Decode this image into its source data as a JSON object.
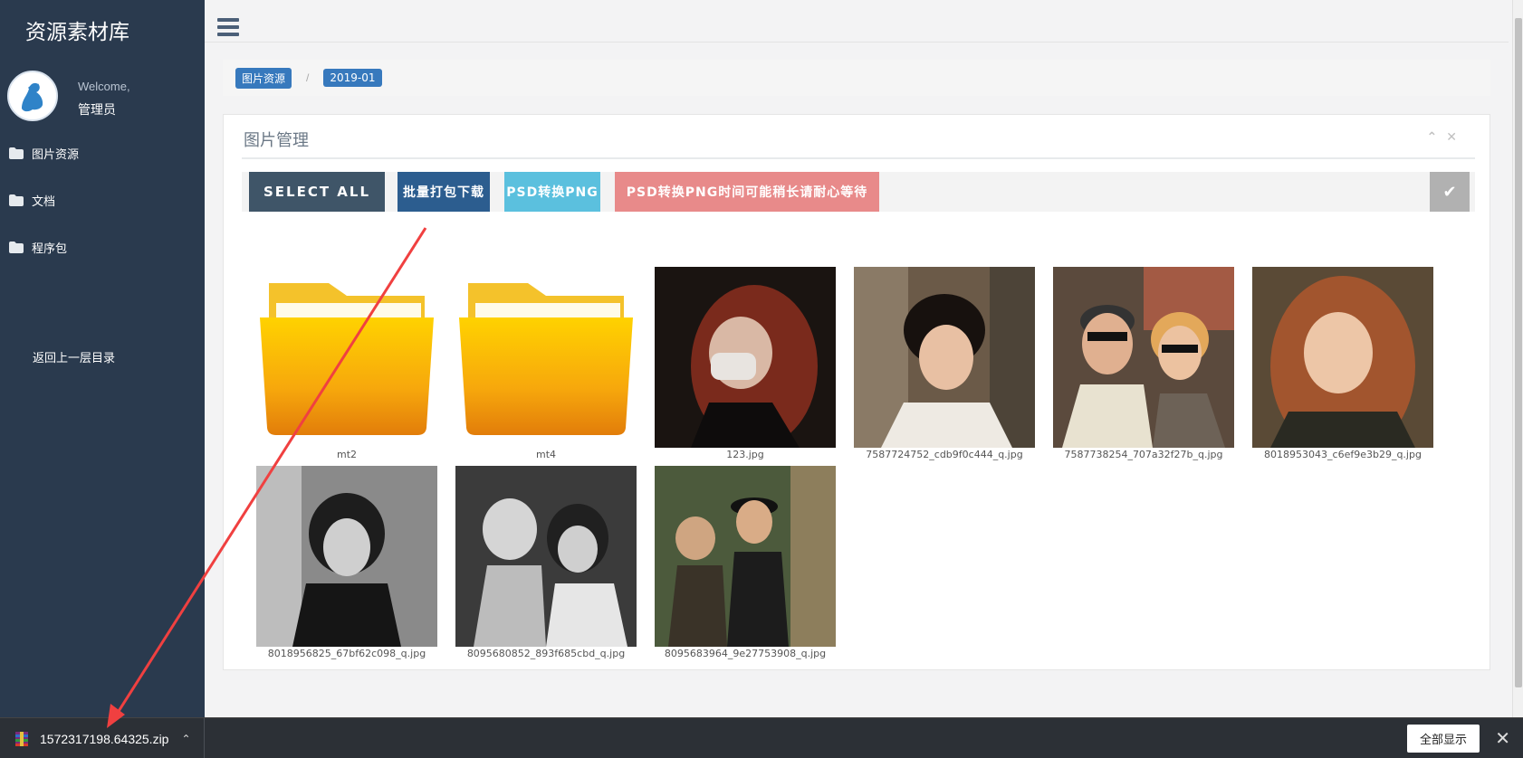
{
  "sidebar": {
    "brand": "资源素材库",
    "welcome": "Welcome,",
    "username": "管理员",
    "items": [
      {
        "label": "图片资源",
        "icon": "folder-icon"
      },
      {
        "label": "文档",
        "icon": "folder-icon"
      },
      {
        "label": "程序包",
        "icon": "folder-icon"
      }
    ],
    "back_label": "返回上一层目录"
  },
  "breadcrumb": [
    "图片资源",
    "2019-01"
  ],
  "breadcrumb_sep": "/",
  "panel": {
    "title": "图片管理",
    "tools": {
      "collapse": "⌃",
      "close": "✕"
    }
  },
  "toolbar": {
    "select_all": "SELECT ALL",
    "batch_download": "批量打包下载",
    "psd_to_png": "PSD转换PNG",
    "psd_warning": "PSD转换PNG时间可能稍长请耐心等待",
    "confirm_icon": "✔"
  },
  "files": [
    {
      "name": "mt2",
      "type": "folder"
    },
    {
      "name": "mt4",
      "type": "folder"
    },
    {
      "name": "123.jpg",
      "type": "image"
    },
    {
      "name": "7587724752_cdb9f0c444_q.jpg",
      "type": "image"
    },
    {
      "name": "7587738254_707a32f27b_q.jpg",
      "type": "image"
    },
    {
      "name": "8018953043_c6ef9e3b29_q.jpg",
      "type": "image"
    },
    {
      "name": "8018956825_67bf62c098_q.jpg",
      "type": "image"
    },
    {
      "name": "8095680852_893f685cbd_q.jpg",
      "type": "image"
    },
    {
      "name": "8095683964_9e27753908_q.jpg",
      "type": "image"
    }
  ],
  "download_bar": {
    "filename": "1572317198.64325.zip",
    "show_all": "全部显示",
    "caret": "⌃",
    "close": "✕"
  },
  "colors": {
    "sidebar": "#2a3a4e",
    "breadcrumb": "#3779bd",
    "select_all": "#3f5568",
    "batch_download": "#2c5d8f",
    "psd_to_png": "#5bc0de",
    "warning": "#e88a8a"
  }
}
